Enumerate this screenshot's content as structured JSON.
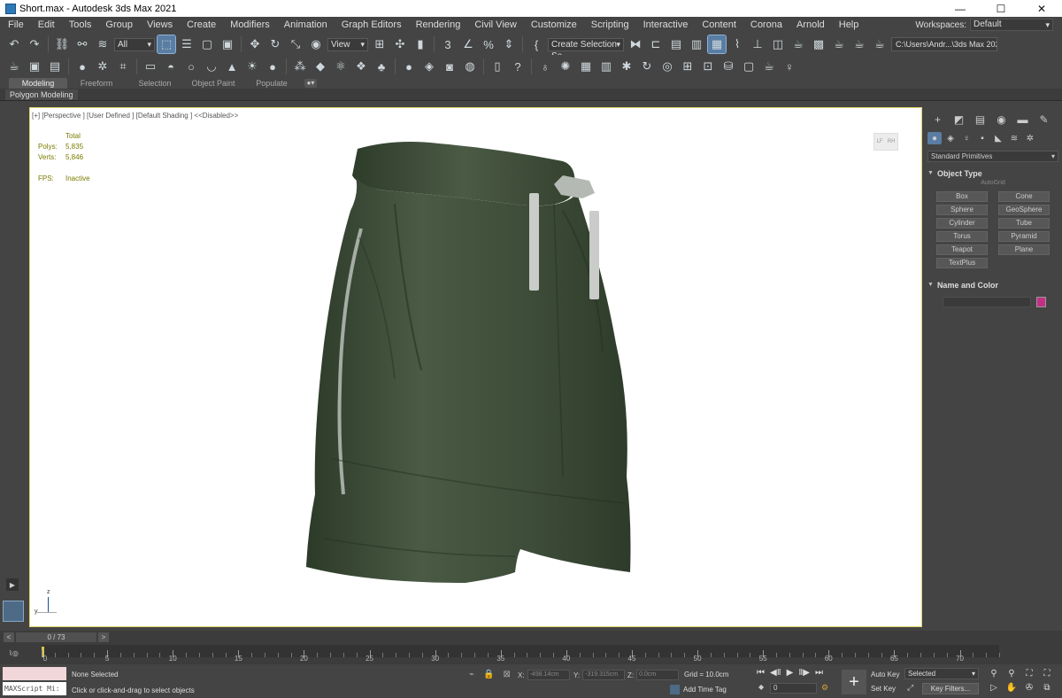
{
  "window": {
    "title": "Short.max - Autodesk 3ds Max 2021",
    "minimize": "—",
    "maximize": "☐",
    "close": "✕"
  },
  "menu": [
    "File",
    "Edit",
    "Tools",
    "Group",
    "Views",
    "Create",
    "Modifiers",
    "Animation",
    "Graph Editors",
    "Rendering",
    "Civil View",
    "Customize",
    "Scripting",
    "Interactive",
    "Content",
    "Corona",
    "Arnold",
    "Help"
  ],
  "workspaces": {
    "label": "Workspaces:",
    "value": "Default"
  },
  "toolbar": {
    "selection_filter": "All",
    "ref_coord": "View",
    "named_selection": "Create Selection Se",
    "project_path": "C:\\Users\\Andr...\\3ds Max 2021"
  },
  "ribbon": {
    "tabs": [
      "Modeling",
      "Freeform",
      "Selection",
      "Object Paint",
      "Populate"
    ],
    "active_tab": "Modeling",
    "panel_label": "Polygon Modeling"
  },
  "viewport": {
    "label": "[+] [Perspective ] [User Defined ] [Default Shading ]  <<Disabled>>",
    "stats_header": "Total",
    "polys_label": "Polys:",
    "polys": "5,835",
    "verts_label": "Verts:",
    "verts": "5,846",
    "fps_label": "FPS:",
    "fps": "Inactive",
    "viewcube_left": "LF",
    "viewcube_right": "RH",
    "axis_z": "z",
    "axis_y": "y"
  },
  "command_panel": {
    "category": "Standard Primitives",
    "object_type_title": "Object Type",
    "autogrid": "AutoGrid",
    "primitives": [
      "Box",
      "Cone",
      "Sphere",
      "GeoSphere",
      "Cylinder",
      "Tube",
      "Torus",
      "Pyramid",
      "Teapot",
      "Plane",
      "TextPlus"
    ],
    "name_color_title": "Name and Color",
    "object_color": "#c42f85"
  },
  "time_slider": {
    "value": "0 / 73",
    "prev": "<",
    "next": ">"
  },
  "trackbar": {
    "labels": [
      "0",
      "5",
      "10",
      "15",
      "20",
      "25",
      "30",
      "35",
      "40",
      "45",
      "50",
      "55",
      "60",
      "65",
      "70"
    ]
  },
  "status": {
    "selection": "None Selected",
    "prompt": "Click or click-and-drag to select objects",
    "script_placeholder": "MAXScript Mi:",
    "x_label": "X:",
    "x": "-498.14cm",
    "y_label": "Y:",
    "y": "-319.315cm",
    "z_label": "Z:",
    "z": "0.0cm",
    "grid": "Grid = 10.0cm",
    "add_time_tag": "Add Time Tag",
    "frame": "0",
    "auto_key": "Auto Key",
    "set_key": "Set Key",
    "selected": "Selected",
    "key_filters": "Key Filters..."
  }
}
